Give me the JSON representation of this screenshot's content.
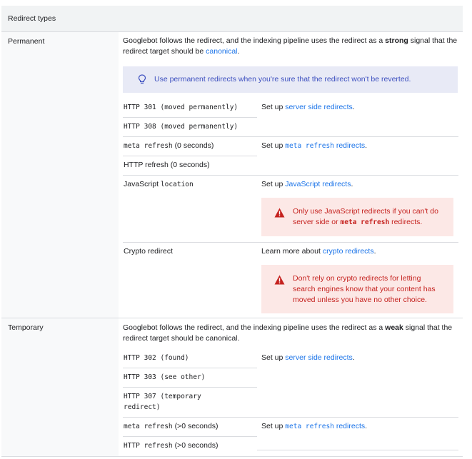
{
  "table_header": "Redirect types",
  "permanent": {
    "label": "Permanent",
    "desc_pre": "Googlebot follows the redirect, and the indexing pipeline uses the redirect as a",
    "desc_bold": "strong",
    "desc_post": "signal that the",
    "desc_line2_pre": "redirect target should be",
    "desc_link": "canonical",
    "desc_end": ".",
    "note": "Use permanent redirects when you're sure that the redirect won't be reverted.",
    "http301": "HTTP 301 (moved permanently)",
    "http308": "HTTP 308 (moved permanently)",
    "server_side_pre": "Set up",
    "server_side_link": "server side redirects",
    "server_side_end": ".",
    "meta_code": "meta refresh",
    "meta_suffix": "(0 seconds)",
    "http_refresh": "HTTP refresh (0 seconds)",
    "meta_setup_pre": "Set up",
    "meta_setup_code": "meta refresh",
    "meta_setup_link": "redirects",
    "meta_setup_end": ".",
    "js_label": "JavaScript",
    "js_code": "location",
    "js_setup_pre": "Set up",
    "js_setup_link": "JavaScript redirects",
    "js_setup_end": ".",
    "js_warn_line1": "Only use JavaScript redirects if you can't do",
    "js_warn_line2_pre": "server side or",
    "js_warn_code": "meta refresh",
    "js_warn_line2_post": "redirects.",
    "crypto_label": "Crypto redirect",
    "crypto_pre": "Learn more about",
    "crypto_link": "crypto redirects",
    "crypto_end": ".",
    "crypto_warn_line1": "Don't rely on crypto redirects for letting",
    "crypto_warn_line2": "search engines know that your content has",
    "crypto_warn_line3": "moved unless you have no other choice."
  },
  "temporary": {
    "label": "Temporary",
    "desc_pre": "Googlebot follows the redirect, and the indexing pipeline uses the redirect as a",
    "desc_bold": "weak",
    "desc_post": "signal that the",
    "desc_line2": "redirect target should be canonical.",
    "http302": "HTTP 302 (found)",
    "http303": "HTTP 303 (see other)",
    "http307_line1": "HTTP 307 (temporary",
    "http307_line2": "redirect)",
    "server_side_pre": "Set up",
    "server_side_link": "server side redirects",
    "server_side_end": ".",
    "meta_code": "meta refresh",
    "meta_suffix": "(>0 seconds)",
    "http_refresh_code": "HTTP refresh",
    "http_refresh_suffix": "(>0 seconds)",
    "meta_setup_pre": "Set up",
    "meta_setup_code": "meta refresh",
    "meta_setup_link": "redirects",
    "meta_setup_end": "."
  },
  "icons": {
    "note": "lightbulb-icon",
    "warning": "warning-triangle-icon"
  },
  "colors": {
    "link": "#1a73e8",
    "note_bg": "#e8eaf6",
    "note_text": "#3c4fbf",
    "warning_bg": "#fce8e6",
    "warning_text": "#c5221f"
  }
}
